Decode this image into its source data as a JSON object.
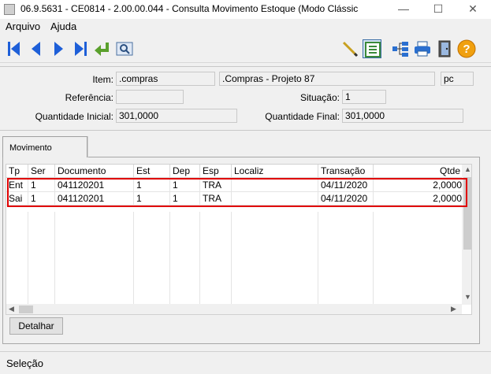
{
  "window": {
    "title": "06.9.5631 - CE0814 - 2.00.00.044 - Consulta Movimento Estoque (Modo Clássic",
    "minimize_glyph": "—",
    "maximize_glyph": "☐",
    "close_glyph": "✕"
  },
  "menu": {
    "items": [
      "Arquivo",
      "Ajuda"
    ]
  },
  "toolbar": {
    "icons": [
      "first-record-icon",
      "previous-record-icon",
      "next-record-icon",
      "last-record-icon",
      "goto-record-icon",
      "zoom-search-icon",
      "edit-pencil-icon",
      "record-details-icon",
      "tree-structure-icon",
      "print-icon",
      "exit-door-icon",
      "help-icon"
    ]
  },
  "header": {
    "item_label": "Item:",
    "item_code": ".compras",
    "item_desc": ".Compras - Projeto 87",
    "unit": "pc",
    "referencia_label": "Referência:",
    "referencia_value": "",
    "situacao_label": "Situação:",
    "situacao_value": "1",
    "qtd_inicial_label": "Quantidade Inicial:",
    "qtd_inicial_value": "301,0000",
    "qtd_final_label": "Quantidade Final:",
    "qtd_final_value": "301,0000"
  },
  "tabs": [
    {
      "label": "Movimento"
    }
  ],
  "grid": {
    "columns": [
      "Tp",
      "Ser",
      "Documento",
      "Est",
      "Dep",
      "Esp",
      "Localiz",
      "Transação",
      "Qtde"
    ],
    "rows": [
      [
        "Ent",
        "1",
        "041120201",
        "1",
        "1",
        "TRA",
        "",
        "04/11/2020",
        "2,0000"
      ],
      [
        "Sai",
        "1",
        "041120201",
        "1",
        "1",
        "TRA",
        "",
        "04/11/2020",
        "2,0000"
      ]
    ]
  },
  "buttons": {
    "detalhar": "Detalhar"
  },
  "status": {
    "text": "Seleção"
  },
  "colors": {
    "highlight": "#e00000",
    "nav_blue": "#1e5fd8",
    "window_bg": "#f0f0f0"
  }
}
